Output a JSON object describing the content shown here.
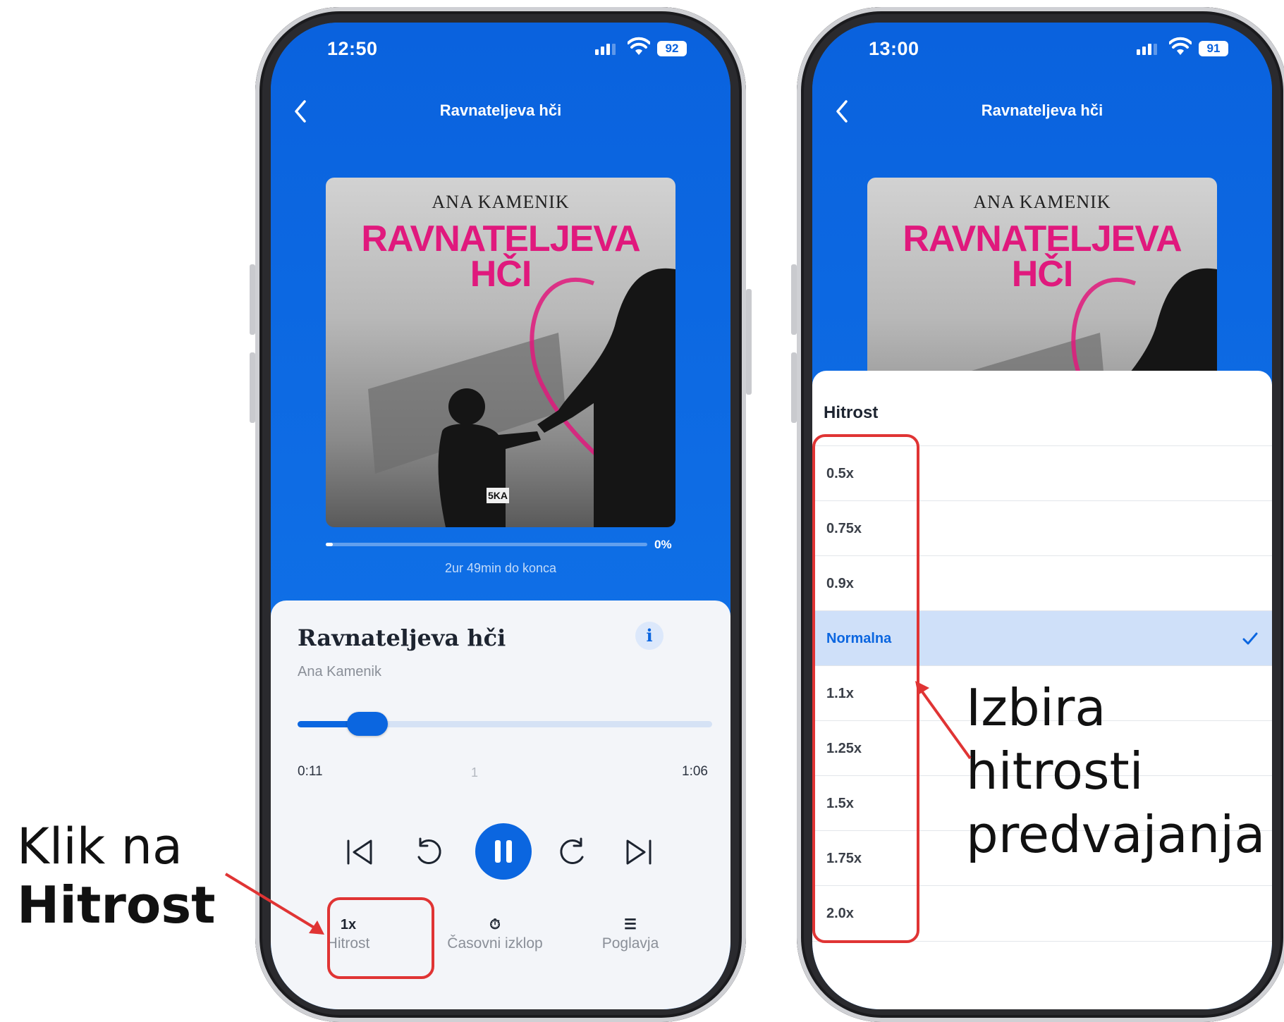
{
  "left_phone": {
    "status": {
      "time": "12:50",
      "battery": "92"
    },
    "nav_title": "Ravnateljeva hči",
    "cover": {
      "author": "ANA KAMENIK",
      "title_line1": "RAVNATELJEVA",
      "title_line2": "HČI",
      "publisher_mark": "5KA"
    },
    "progress": {
      "percent_label": "0%",
      "fraction": 0.0,
      "remaining": "2ur 49min do konca"
    },
    "panel": {
      "title": "Ravnateljeva hči",
      "author": "Ana Kamenik",
      "info_label": "i",
      "seek": {
        "elapsed": "0:11",
        "chapter": "1",
        "duration": "1:06",
        "fraction": 0.17
      },
      "tabs": [
        {
          "top": "1x",
          "label": "Hitrost"
        },
        {
          "top": "⏱",
          "label": "Časovni izklop"
        },
        {
          "top": "☰",
          "label": "Poglavja"
        }
      ]
    }
  },
  "right_phone": {
    "status": {
      "time": "13:00",
      "battery": "91"
    },
    "nav_title": "Ravnateljeva hči",
    "cover": {
      "author": "ANA KAMENIK",
      "title_line1": "RAVNATELJEVA",
      "title_line2": "HČI"
    },
    "sheet": {
      "title": "Hitrost",
      "options": [
        "0.5x",
        "0.75x",
        "0.9x",
        "Normalna",
        "1.1x",
        "1.25x",
        "1.5x",
        "1.75x",
        "2.0x"
      ],
      "selected": "Normalna"
    }
  },
  "annotations": {
    "left_line1": "Klik na",
    "left_line2": "Hitrost",
    "right_line1": "Izbira",
    "right_line2": "hitrosti",
    "right_line3": "predvajanja"
  },
  "colors": {
    "accent": "#0b66e0",
    "annotation": "#e03434",
    "cover_title": "#e0197d"
  }
}
